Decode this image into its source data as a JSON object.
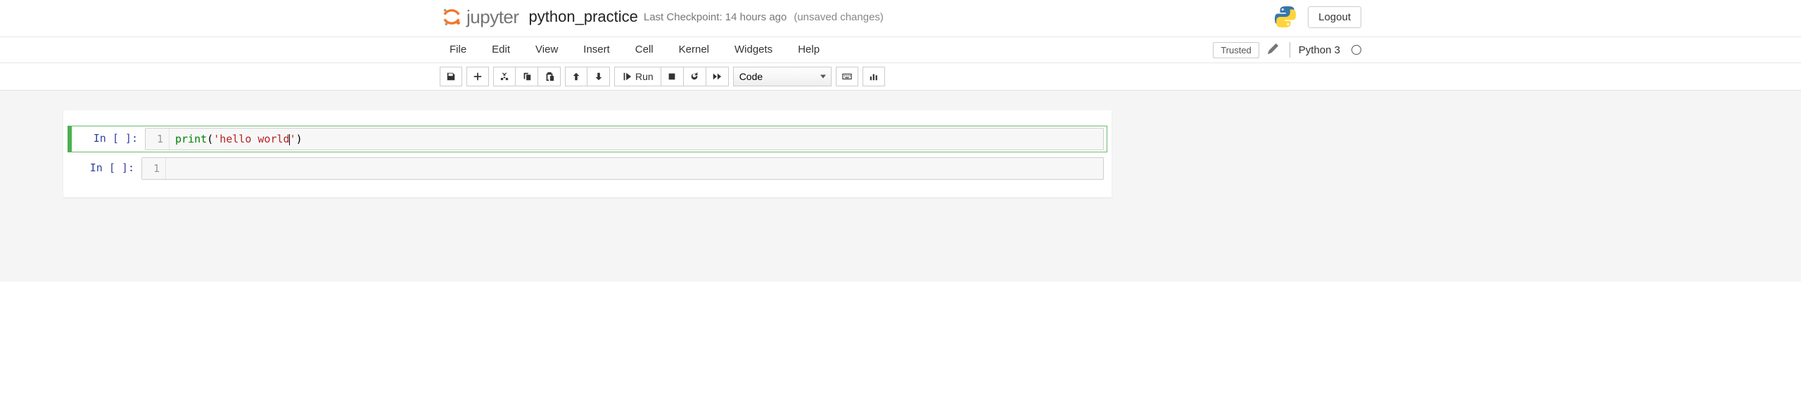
{
  "header": {
    "logo_text": "jupyter",
    "notebook_name": "python_practice",
    "checkpoint": "Last Checkpoint: 14 hours ago",
    "autosave": "(unsaved changes)",
    "logout": "Logout"
  },
  "menubar": {
    "items": [
      "File",
      "Edit",
      "View",
      "Insert",
      "Cell",
      "Kernel",
      "Widgets",
      "Help"
    ],
    "trusted": "Trusted",
    "kernel_name": "Python 3"
  },
  "toolbar": {
    "run_label": "Run",
    "cell_type": "Code"
  },
  "cells": [
    {
      "prompt": "In [ ]:",
      "line_no": "1",
      "code": {
        "builtin": "print",
        "open": "(",
        "quote1": "'",
        "str": "hello world",
        "quote2": "'",
        "close": ")"
      },
      "selected": true
    },
    {
      "prompt": "In [ ]:",
      "line_no": "1",
      "code": null,
      "selected": false
    }
  ]
}
